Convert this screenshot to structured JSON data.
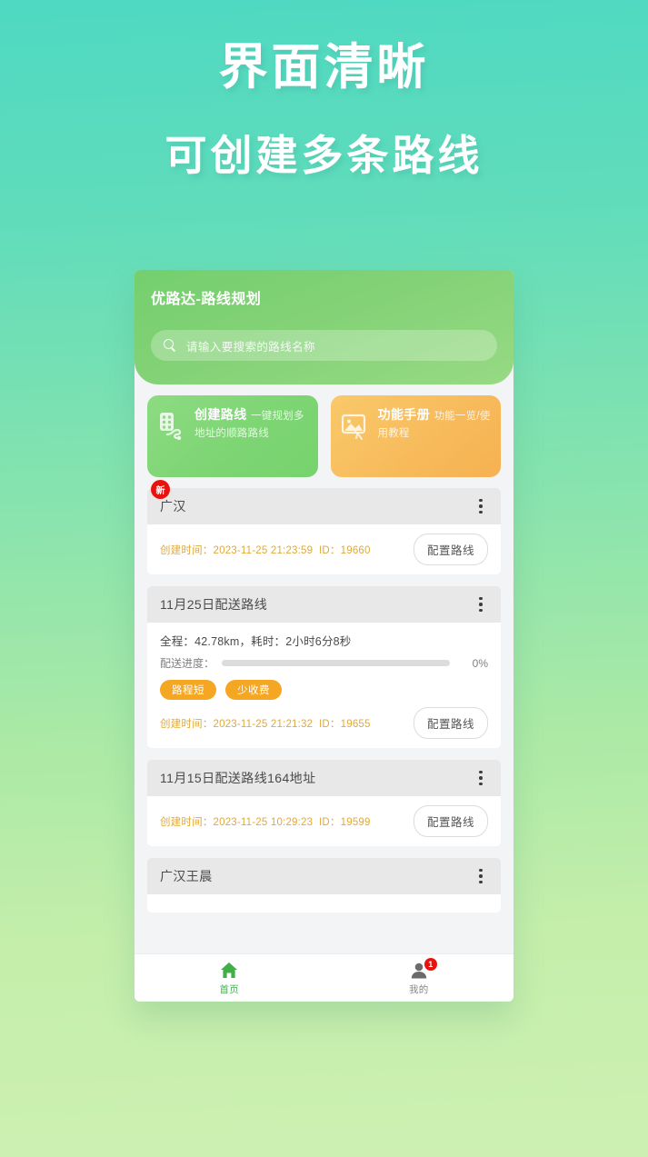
{
  "promo": {
    "line1": "界面清晰",
    "line2": "可创建多条路线"
  },
  "app": {
    "title": "优路达-路线规划",
    "search": {
      "placeholder": "请输入要搜索的路线名称",
      "value": "",
      "icon": "search-icon"
    }
  },
  "quick_actions": [
    {
      "title": "创建路线",
      "subtitle": "一键规划多地址的顺路路线",
      "icon": "route-building-icon",
      "color": "#7dd573"
    },
    {
      "title": "功能手册",
      "subtitle": "功能一览/使用教程",
      "icon": "image-placeholder-icon",
      "color": "#f7bb5c"
    }
  ],
  "routes": [
    {
      "name": "广汉",
      "badge": "新",
      "has_stats": false,
      "created_label": "创建时间：",
      "created_time": "2023-11-25 21:23:59",
      "id_label": "ID：",
      "id": "19660",
      "config_label": "配置路线",
      "menu_icon": "more-vertical-icon"
    },
    {
      "name": "11月25日配送路线",
      "badge": "",
      "has_stats": true,
      "stats": "全程：42.78km，耗时：2小时6分8秒",
      "progress_label": "配送进度：",
      "progress_value": "0%",
      "progress_percent": 0,
      "tags": [
        "路程短",
        "少收费"
      ],
      "created_label": "创建时间：",
      "created_time": "2023-11-25 21:21:32",
      "id_label": "ID：",
      "id": "19655",
      "config_label": "配置路线",
      "menu_icon": "more-vertical-icon"
    },
    {
      "name": "11月15日配送路线164地址",
      "badge": "",
      "has_stats": false,
      "created_label": "创建时间：",
      "created_time": "2023-11-25 10:29:23",
      "id_label": "ID：",
      "id": "19599",
      "config_label": "配置路线",
      "menu_icon": "more-vertical-icon"
    },
    {
      "name": "广汉王晨",
      "badge": "",
      "has_stats": false,
      "menu_icon": "more-vertical-icon"
    }
  ],
  "tabbar": [
    {
      "label": "首页",
      "icon": "home-icon",
      "active": true,
      "badge": ""
    },
    {
      "label": "我的",
      "icon": "person-icon",
      "active": false,
      "badge": "1"
    }
  ],
  "colors": {
    "background_top": "#4fd9c2",
    "background_bottom": "#cdf0b2",
    "header_green": "#7dd573",
    "accent_orange": "#f5a623",
    "badge_red": "#e8130f",
    "time_text": "#e0a93a",
    "tab_active": "#4caf50"
  }
}
